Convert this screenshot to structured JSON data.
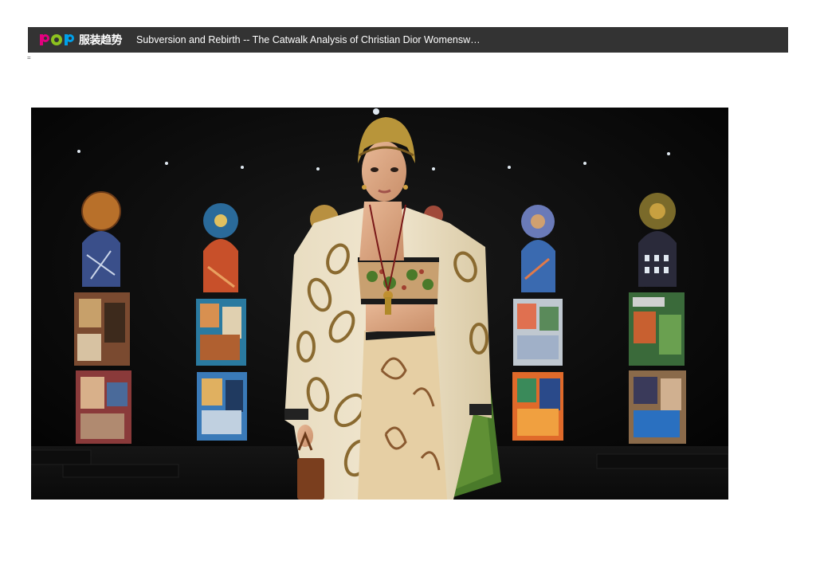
{
  "header": {
    "logo_latin": "POP",
    "logo_cn": "服装趋势",
    "title": "Subversion and Rebirth -- The Catwalk Analysis of Christian Dior Womensw…"
  },
  "page_mark": "=",
  "photo": {
    "alt": "Runway model in paisley kimono coat"
  },
  "colors": {
    "header_bg": "#333333",
    "logo_p": "#e4007f",
    "logo_o": "#8dc21f",
    "logo_p2": "#00a0e9"
  }
}
